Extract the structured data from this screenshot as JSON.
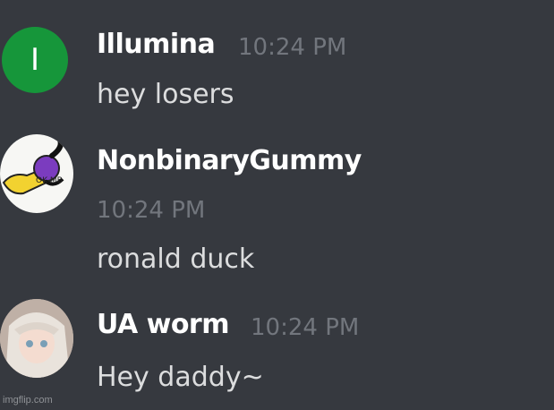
{
  "messages": [
    {
      "author": "Illumina",
      "avatar_initial": "I",
      "avatar_color": "#16963a",
      "time": "10:24 PM",
      "text": "hey losers"
    },
    {
      "author": "NonbinaryGummy",
      "avatar_badge": "OK MB",
      "time": "10:24 PM",
      "text": "ronald duck"
    },
    {
      "author": "UA worm",
      "time": "10:24 PM",
      "text": "Hey daddy~"
    }
  ],
  "watermark": "imgflip.com",
  "colors": {
    "background": "#36393f",
    "username": "#ffffff",
    "timestamp": "#72767d",
    "message": "#dcddde"
  }
}
